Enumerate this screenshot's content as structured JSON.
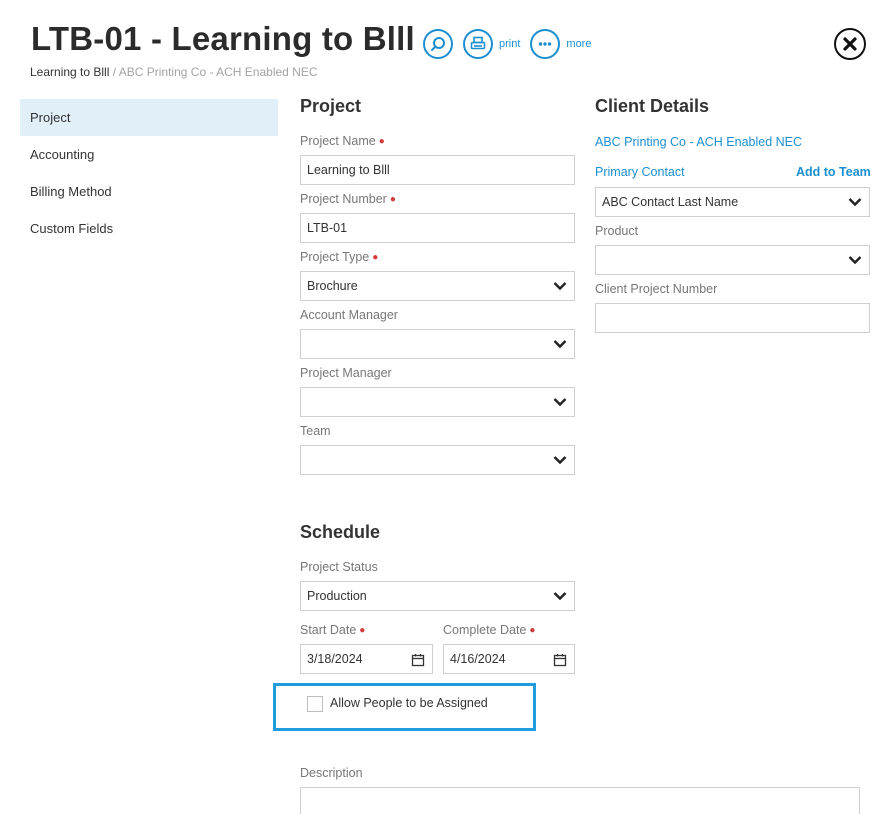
{
  "header": {
    "title": "LTB-01 - Learning to Blll",
    "print_label": "print",
    "more_label": "more",
    "breadcrumb": {
      "current": "Learning to Blll",
      "separator": "/",
      "parent": "ABC Printing Co - ACH Enabled NEC"
    }
  },
  "sidebar": {
    "items": [
      {
        "label": "Project",
        "active": true
      },
      {
        "label": "Accounting"
      },
      {
        "label": "Billing Method"
      },
      {
        "label": "Custom Fields"
      }
    ]
  },
  "project": {
    "title": "Project",
    "name_label": "Project Name",
    "name_value": "Learning to Blll",
    "number_label": "Project Number",
    "number_value": "LTB-01",
    "type_label": "Project Type",
    "type_value": "Brochure",
    "account_manager_label": "Account Manager",
    "account_manager_value": "",
    "project_manager_label": "Project Manager",
    "project_manager_value": "",
    "team_label": "Team",
    "team_value": ""
  },
  "client": {
    "title": "Client Details",
    "client_name": "ABC Printing Co - ACH Enabled NEC",
    "primary_contact_label": "Primary Contact",
    "add_to_team_label": "Add to Team",
    "primary_contact_value": "ABC Contact Last Name",
    "product_label": "Product",
    "product_value": "",
    "client_project_number_label": "Client Project Number",
    "client_project_number_value": ""
  },
  "schedule": {
    "title": "Schedule",
    "status_label": "Project Status",
    "status_value": "Production",
    "start_label": "Start Date",
    "start_value": "3/18/2024",
    "complete_label": "Complete Date",
    "complete_value": "4/16/2024",
    "allow_assign_label": "Allow People to be Assigned",
    "allow_assign_checked": false
  },
  "description": {
    "label": "Description",
    "value": ""
  },
  "colors": {
    "accent": "#1c8fd0",
    "highlight": "#1f9bde",
    "required": "#d33a3a",
    "active_nav": "#e1eff9"
  }
}
